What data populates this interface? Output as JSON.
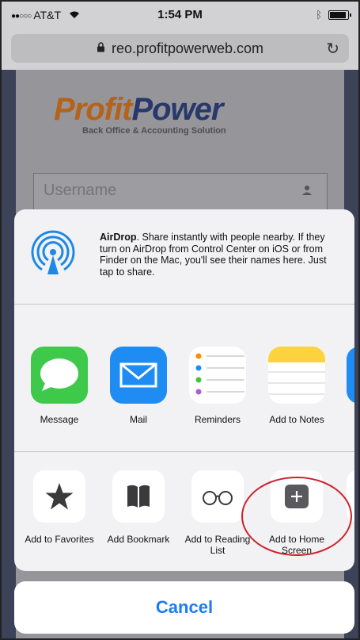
{
  "status": {
    "carrier": "AT&T",
    "time": "1:54 PM"
  },
  "browser": {
    "url": "reo.profitpowerweb.com"
  },
  "page": {
    "logo": {
      "part1": "Profit",
      "part2": "Power",
      "tagline": "Back Office & Accounting Solution"
    },
    "username_placeholder": "Username"
  },
  "share_sheet": {
    "airdrop": {
      "title": "AirDrop",
      "description": ". Share instantly with people nearby. If they turn on AirDrop from Control Center on iOS or from Finder on the Mac, you'll see their names here. Just tap to share."
    },
    "apps": [
      {
        "label": "Message",
        "icon": "messages-icon"
      },
      {
        "label": "Mail",
        "icon": "mail-icon"
      },
      {
        "label": "Reminders",
        "icon": "reminders-icon"
      },
      {
        "label": "Add to Notes",
        "icon": "notes-icon"
      }
    ],
    "actions": [
      {
        "label": "Add to Favorites",
        "icon": "star-icon"
      },
      {
        "label": "Add Bookmark",
        "icon": "book-icon"
      },
      {
        "label": "Add to Reading List",
        "icon": "glasses-icon"
      },
      {
        "label": "Add to Home Screen",
        "icon": "plus-square-icon"
      }
    ],
    "cancel_label": "Cancel"
  },
  "colors": {
    "accent": "#1a7cf5",
    "highlight_circle": "#d0202a",
    "logo_orange": "#b5621a",
    "logo_navy": "#28386a"
  }
}
